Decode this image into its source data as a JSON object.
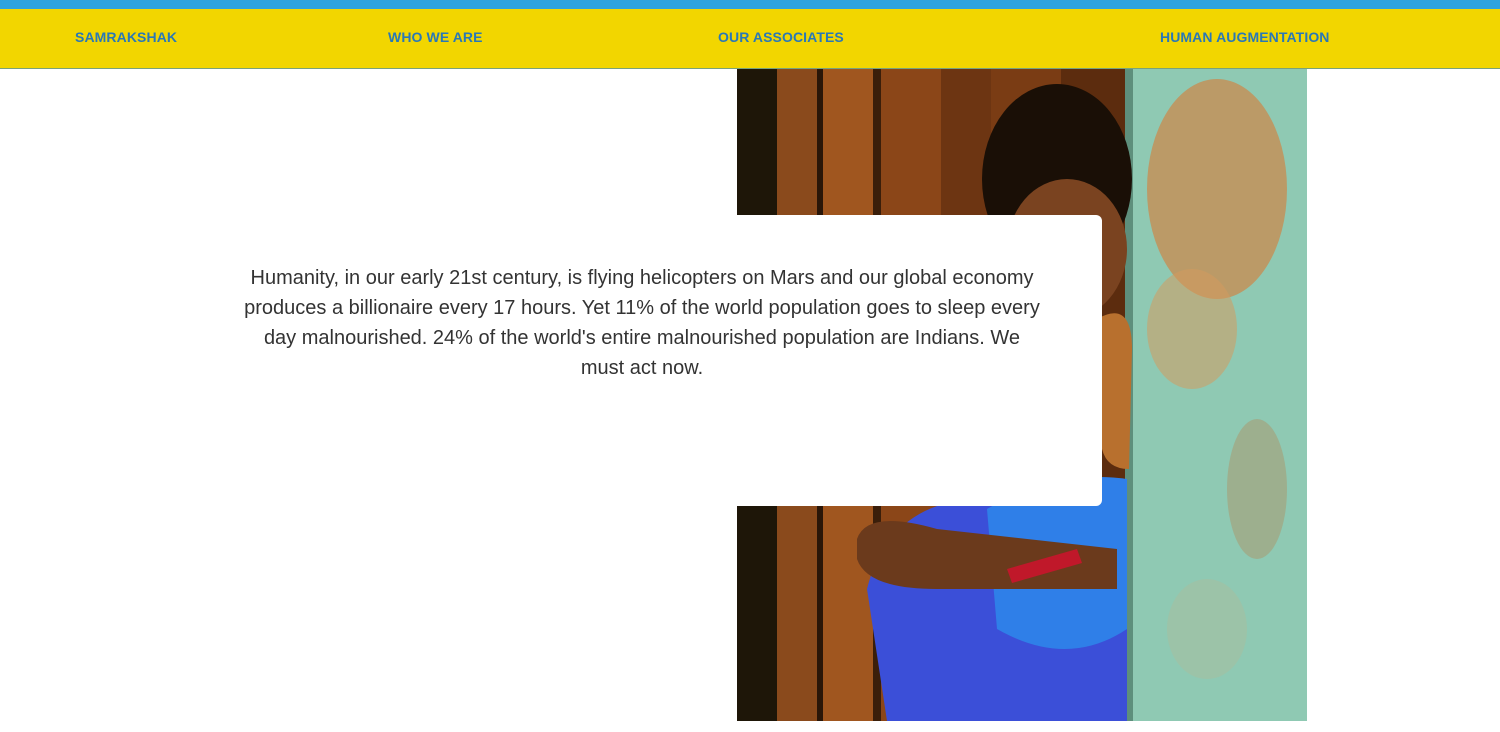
{
  "nav": {
    "items": [
      {
        "label": "SAMRAKSHAK"
      },
      {
        "label": "WHO WE ARE"
      },
      {
        "label": "OUR ASSOCIATES"
      },
      {
        "label": "HUMAN AUGMENTATION"
      }
    ]
  },
  "hero": {
    "quote": "Humanity, in our early 21st century, is flying helicopters on Mars and our global economy produces a billionaire every 17 hours. Yet 11% of the world population goes to sleep every day malnourished. 24% of the world's entire malnourished population are Indians. We must act now."
  },
  "colors": {
    "top_strip": "#2ea3de",
    "navbar_bg": "#f2d600",
    "nav_link": "#2a78b6",
    "quote_text": "#333333"
  }
}
